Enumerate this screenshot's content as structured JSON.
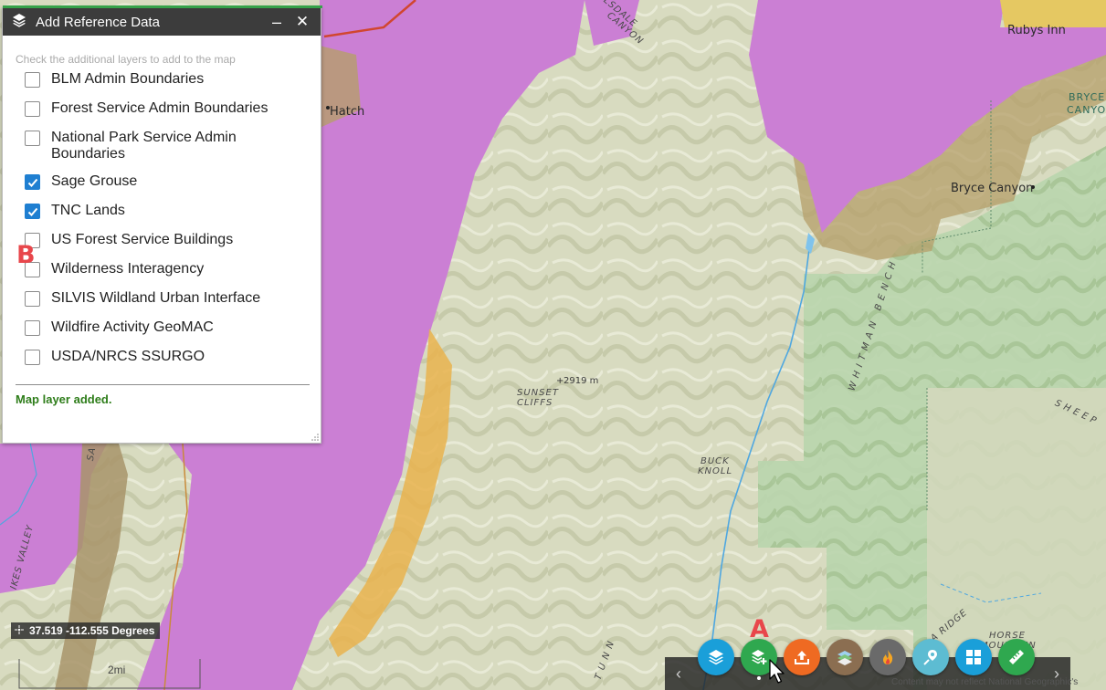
{
  "panel": {
    "title": "Add Reference Data",
    "minimize_label": "–",
    "close_label": "✕",
    "instructions": "Check the additional layers to add to the map",
    "layers": [
      {
        "label": "BLM Admin Boundaries",
        "checked": false
      },
      {
        "label": "Forest Service Admin Boundaries",
        "checked": false
      },
      {
        "label": "National Park Service Admin Boundaries",
        "checked": false
      },
      {
        "label": "Sage Grouse",
        "checked": true
      },
      {
        "label": "TNC Lands",
        "checked": true
      },
      {
        "label": "US Forest Service Buildings",
        "checked": false
      },
      {
        "label": "Wilderness Interagency",
        "checked": false
      },
      {
        "label": "SILVIS Wildland Urban Interface",
        "checked": false
      },
      {
        "label": "Wildfire Activity GeoMAC",
        "checked": false
      },
      {
        "label": "USDA/NRCS SSURGO",
        "checked": false
      }
    ],
    "status": "Map layer added."
  },
  "annotations": {
    "a": "A",
    "b": "B"
  },
  "map": {
    "labels": {
      "rubys_inn": "Rubys Inn",
      "hatch": "Hatch",
      "bryce_canyon_town": "Bryce Canyon",
      "bryce_canyon_park_1": "BRYCE",
      "bryce_canyon_park_2": "CANYON",
      "hillsdale_canyon_1": "HILLSDALE",
      "hillsdale_canyon_2": "CANYON",
      "sunset_cliffs_1": "SUNSET",
      "sunset_cliffs_2": "CLIFFS",
      "elevation": "2919 m",
      "buck_knoll_1": "BUCK",
      "buck_knoll_2": "KNOLL",
      "whitman_bench": "WHITMAN BENCH",
      "sheep": "SHEEP",
      "horse_mountain_1": "HORSE",
      "horse_mountain_2": "MOUNTAIN",
      "ridge": "A RIDGE",
      "ikes_valley": "IKES VALLEY",
      "sa": "SA",
      "tunnel": "T U N N"
    }
  },
  "coordinates": {
    "text": "37.519 -112.555 Degrees"
  },
  "scale": {
    "label": "2mi"
  },
  "toolbar": {
    "prev_label": "‹",
    "next_label": "›",
    "tools": [
      {
        "name": "layers",
        "color": "#1a9fd9",
        "icon": "layers-icon"
      },
      {
        "name": "add-data",
        "color": "#2fa84f",
        "icon": "layers-add-icon"
      },
      {
        "name": "upload",
        "color": "#ef6a22",
        "icon": "upload-icon"
      },
      {
        "name": "basemap",
        "color": "#8b6e51",
        "icon": "basemap-icon"
      },
      {
        "name": "fire",
        "color": "#6a6a6a",
        "icon": "fire-icon"
      },
      {
        "name": "draw",
        "color": "#5dbcd2",
        "icon": "marker-icon"
      },
      {
        "name": "widgets",
        "color": "#1a9fd9",
        "icon": "grid-icon"
      },
      {
        "name": "measure",
        "color": "#2fa84f",
        "icon": "ruler-icon"
      }
    ]
  },
  "attribution": "Content may not reflect National Geographic's"
}
